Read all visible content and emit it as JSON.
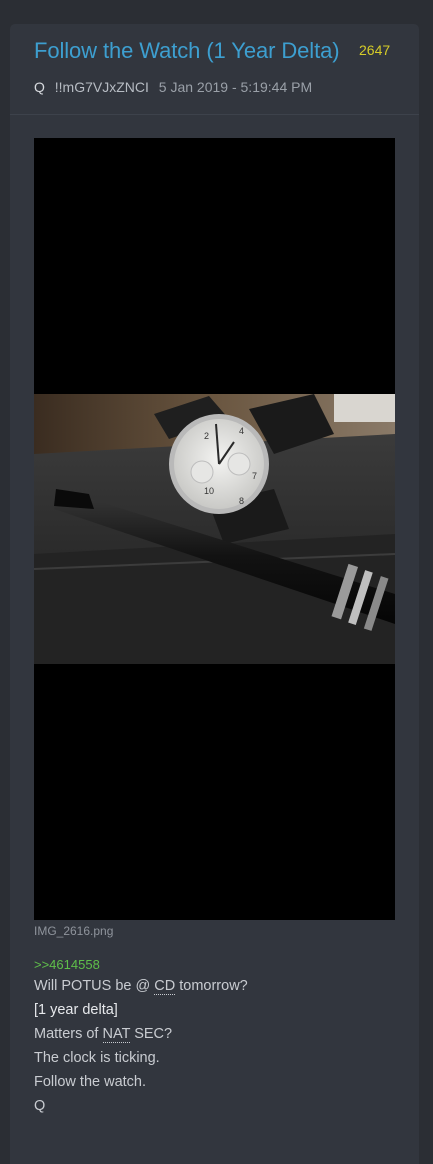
{
  "post": {
    "title": "Follow the Watch (1 Year Delta)",
    "number": "2647",
    "author": "Q",
    "tripcode": "!!mG7VJxZNCI",
    "date": "5 Jan 2019 - 5:19:44 PM"
  },
  "attachment": {
    "filename": "IMG_2616.png",
    "alt": "watch and pen photo"
  },
  "body": {
    "quote_link": ">>4614558",
    "line1_prefix": "Will POTUS be @ ",
    "line1_abbr": "CD",
    "line1_suffix": " tomorrow?",
    "line2": "[1 year delta]",
    "line3_prefix": "Matters of ",
    "line3_abbr": "NAT",
    "line3_suffix": " SEC?",
    "line4": "The clock is ticking.",
    "line5": "Follow the watch.",
    "signature": "Q"
  },
  "colors": {
    "background": "#2b2e34",
    "card": "#32363e",
    "title": "#3d9fd0",
    "post_number": "#d6cc28",
    "quote_link": "#5fbf4a"
  }
}
